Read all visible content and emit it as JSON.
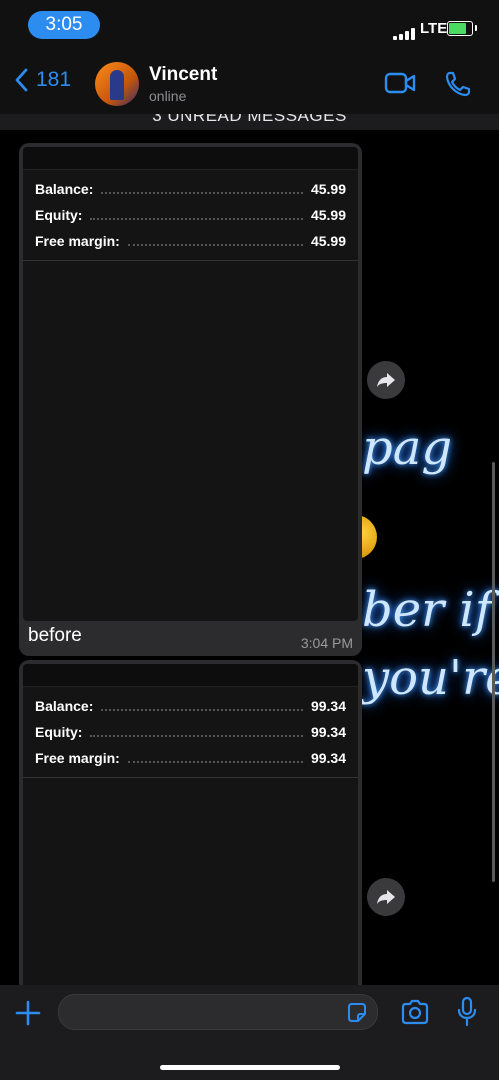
{
  "status": {
    "time": "3:05",
    "network": "LTE"
  },
  "header": {
    "back_count": "181",
    "contact_name": "Vincent",
    "contact_status": "online"
  },
  "unread_banner": "3 UNREAD MESSAGES",
  "wallpaper_text": [
    "pag",
    "ber if",
    "you're"
  ],
  "messages": [
    {
      "screenshot": {
        "rows": [
          {
            "label": "Balance:",
            "value": "45.99"
          },
          {
            "label": "Equity:",
            "value": "45.99"
          },
          {
            "label": "Free margin:",
            "value": "45.99"
          }
        ]
      },
      "caption": "before",
      "time": "3:04 PM"
    },
    {
      "screenshot": {
        "rows": [
          {
            "label": "Balance:",
            "value": "99.34"
          },
          {
            "label": "Equity:",
            "value": "99.34"
          },
          {
            "label": "Free margin:",
            "value": "99.34"
          }
        ]
      }
    }
  ],
  "composer": {
    "placeholder": ""
  },
  "colors": {
    "accent": "#2d8cf0",
    "bubble": "#2c2c2e",
    "background": "#000000"
  }
}
